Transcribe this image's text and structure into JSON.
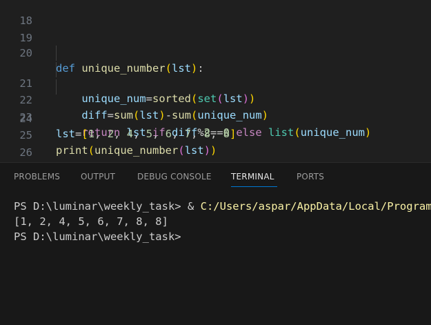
{
  "editor": {
    "lines": [
      {
        "number": "18",
        "tokens": []
      },
      {
        "number": "19",
        "tokens": []
      },
      {
        "number": "20",
        "tokens": [
          {
            "text": "def ",
            "color": "#569cd6"
          },
          {
            "text": "unique_number",
            "color": "#dcdcaa"
          },
          {
            "text": "(",
            "color": "#ffd700"
          },
          {
            "text": "lst",
            "color": "#9cdcfe"
          },
          {
            "text": ")",
            "color": "#ffd700"
          },
          {
            "text": ":",
            "color": "#cccccc"
          }
        ]
      },
      {
        "number": "21",
        "tokens": [
          {
            "text": "    ",
            "color": "#cccccc"
          },
          {
            "text": "unique_num",
            "color": "#9cdcfe"
          },
          {
            "text": "=",
            "color": "#d4d4d4"
          },
          {
            "text": "sorted",
            "color": "#dcdcaa"
          },
          {
            "text": "(",
            "color": "#ffd700"
          },
          {
            "text": "set",
            "color": "#4ec9b0"
          },
          {
            "text": "(",
            "color": "#da70d6"
          },
          {
            "text": "lst",
            "color": "#9cdcfe"
          },
          {
            "text": ")",
            "color": "#da70d6"
          },
          {
            "text": ")",
            "color": "#ffd700"
          }
        ]
      },
      {
        "number": "22",
        "tokens": [
          {
            "text": "    ",
            "color": "#cccccc"
          },
          {
            "text": "diff",
            "color": "#9cdcfe"
          },
          {
            "text": "=",
            "color": "#d4d4d4"
          },
          {
            "text": "sum",
            "color": "#dcdcaa"
          },
          {
            "text": "(",
            "color": "#ffd700"
          },
          {
            "text": "lst",
            "color": "#9cdcfe"
          },
          {
            "text": ")",
            "color": "#ffd700"
          },
          {
            "text": "-",
            "color": "#d4d4d4"
          },
          {
            "text": "sum",
            "color": "#dcdcaa"
          },
          {
            "text": "(",
            "color": "#ffd700"
          },
          {
            "text": "unique_num",
            "color": "#9cdcfe"
          },
          {
            "text": ")",
            "color": "#ffd700"
          }
        ]
      },
      {
        "number": "23",
        "tokens": [
          {
            "text": "    ",
            "color": "#cccccc"
          },
          {
            "text": "return ",
            "color": "#c586c0"
          },
          {
            "text": "lst ",
            "color": "#9cdcfe"
          },
          {
            "text": "if ",
            "color": "#c586c0"
          },
          {
            "text": "diff",
            "color": "#9cdcfe"
          },
          {
            "text": "%",
            "color": "#d4d4d4"
          },
          {
            "text": "2",
            "color": "#b5cea8"
          },
          {
            "text": "==",
            "color": "#d4d4d4"
          },
          {
            "text": "0 ",
            "color": "#b5cea8"
          },
          {
            "text": "else ",
            "color": "#c586c0"
          },
          {
            "text": "list",
            "color": "#4ec9b0"
          },
          {
            "text": "(",
            "color": "#ffd700"
          },
          {
            "text": "unique_num",
            "color": "#9cdcfe"
          },
          {
            "text": ")",
            "color": "#ffd700"
          }
        ]
      },
      {
        "number": "24",
        "tokens": [
          {
            "text": "lst",
            "color": "#9cdcfe"
          },
          {
            "text": "=",
            "color": "#d4d4d4"
          },
          {
            "text": "[",
            "color": "#ffd700"
          },
          {
            "text": "1",
            "color": "#b5cea8"
          },
          {
            "text": ", ",
            "color": "#cccccc"
          },
          {
            "text": "2",
            "color": "#b5cea8"
          },
          {
            "text": ", ",
            "color": "#cccccc"
          },
          {
            "text": "4",
            "color": "#b5cea8"
          },
          {
            "text": ", ",
            "color": "#cccccc"
          },
          {
            "text": "5",
            "color": "#b5cea8"
          },
          {
            "text": ", ",
            "color": "#cccccc"
          },
          {
            "text": "6",
            "color": "#b5cea8"
          },
          {
            "text": ", ",
            "color": "#cccccc"
          },
          {
            "text": "7",
            "color": "#b5cea8"
          },
          {
            "text": ", ",
            "color": "#cccccc"
          },
          {
            "text": "8",
            "color": "#b5cea8"
          },
          {
            "text": ", ",
            "color": "#cccccc"
          },
          {
            "text": "8",
            "color": "#b5cea8"
          },
          {
            "text": "]",
            "color": "#ffd700"
          }
        ]
      },
      {
        "number": "25",
        "tokens": [
          {
            "text": "print",
            "color": "#dcdcaa"
          },
          {
            "text": "(",
            "color": "#ffd700"
          },
          {
            "text": "unique_number",
            "color": "#dcdcaa"
          },
          {
            "text": "(",
            "color": "#da70d6"
          },
          {
            "text": "lst",
            "color": "#9cdcfe"
          },
          {
            "text": ")",
            "color": "#da70d6"
          },
          {
            "text": ")",
            "color": "#ffd700"
          }
        ]
      },
      {
        "number": "26",
        "tokens": []
      }
    ]
  },
  "panel": {
    "tabs": [
      {
        "label": "PROBLEMS",
        "active": false
      },
      {
        "label": "OUTPUT",
        "active": false
      },
      {
        "label": "DEBUG CONSOLE",
        "active": false
      },
      {
        "label": "TERMINAL",
        "active": true
      },
      {
        "label": "PORTS",
        "active": false
      }
    ],
    "terminal": {
      "lines": [
        [
          {
            "text": "PS D:\\luminar\\weekly_task> ",
            "color": "#cccccc"
          },
          {
            "text": "& ",
            "color": "#cccccc"
          },
          {
            "text": "C:/Users/aspar/AppData/Local/Programs/P",
            "color": "#f9f1a5"
          }
        ],
        [
          {
            "text": "[1, 2, 4, 5, 6, 7, 8, 8]",
            "color": "#cccccc"
          }
        ],
        [
          {
            "text": "PS D:\\luminar\\weekly_task>",
            "color": "#cccccc"
          }
        ]
      ]
    }
  },
  "colors": {
    "editor_bg": "#1f1f1f",
    "panel_bg": "#181818",
    "line_number": "#6e7681",
    "active_tab_underline": "#0078d4"
  }
}
